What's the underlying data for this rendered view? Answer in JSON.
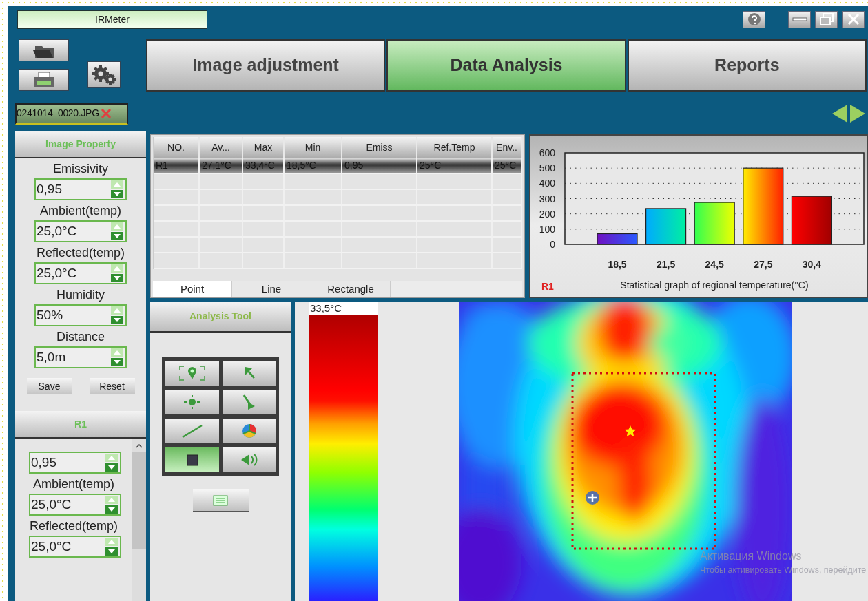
{
  "window": {
    "title": "IRMeter"
  },
  "main_tabs": [
    {
      "label": "Image adjustment",
      "selected": false
    },
    {
      "label": "Data Analysis",
      "selected": true
    },
    {
      "label": "Reports",
      "selected": false
    }
  ],
  "file_tab": {
    "label": "0241014_0020.JPG"
  },
  "image_property": {
    "title": "Image Property",
    "fields": [
      {
        "label": "Emissivity",
        "value": "0,95"
      },
      {
        "label": "Ambient(temp)",
        "value": "25,0°C"
      },
      {
        "label": "Reflected(temp)",
        "value": "25,0°C"
      },
      {
        "label": "Humidity",
        "value": "50%"
      },
      {
        "label": "Distance",
        "value": "5,0m"
      }
    ],
    "buttons": [
      "Save",
      "Reset"
    ]
  },
  "region_panel": {
    "title": "R1",
    "fields": [
      {
        "value": "0,95"
      },
      {
        "label": "Ambient(temp)",
        "value": "25,0°C"
      },
      {
        "label": "Reflected(temp)",
        "value": "25,0°C"
      }
    ]
  },
  "table": {
    "columns": [
      "NO.",
      "Av...",
      "Max",
      "Min",
      "Emiss",
      "Ref.Temp",
      "Env.."
    ],
    "rows": [
      {
        "cells": [
          "R1",
          "27,1°C",
          "33,4°C",
          "18,5°C",
          "0,95",
          "25°C",
          "25°C"
        ],
        "selected": true
      }
    ]
  },
  "table_tabs": [
    {
      "label": "Point",
      "selected": true
    },
    {
      "label": "Line",
      "selected": false
    },
    {
      "label": "Rectangle",
      "selected": false
    }
  ],
  "chart": {
    "region_label": "R1",
    "chart_data": {
      "type": "bar",
      "xlabel": "Statistical graph of regional temperature(°C)",
      "categories": [
        "18,5",
        "21,5",
        "24,5",
        "27,5",
        "30,4"
      ],
      "values": [
        70,
        235,
        275,
        500,
        315
      ],
      "grid": true,
      "ylim": [
        0,
        600
      ],
      "yticks": [
        0,
        100,
        200,
        300,
        400,
        500,
        600
      ]
    }
  },
  "analysis_tool": {
    "title": "Analysis Tool",
    "tools": [
      {
        "kind": "region-point",
        "selected": false
      },
      {
        "kind": "cursor",
        "selected": false
      },
      {
        "kind": "center-point",
        "selected": false
      },
      {
        "kind": "pointer",
        "selected": false
      },
      {
        "kind": "line",
        "selected": false
      },
      {
        "kind": "pie",
        "selected": false
      },
      {
        "kind": "rectangle",
        "selected": true
      },
      {
        "kind": "sound",
        "selected": false
      }
    ]
  },
  "scale": {
    "max_label": "33,5°C"
  },
  "watermark": [
    "Активация Windows",
    "Чтобы активировать Windows, перейдите"
  ]
}
